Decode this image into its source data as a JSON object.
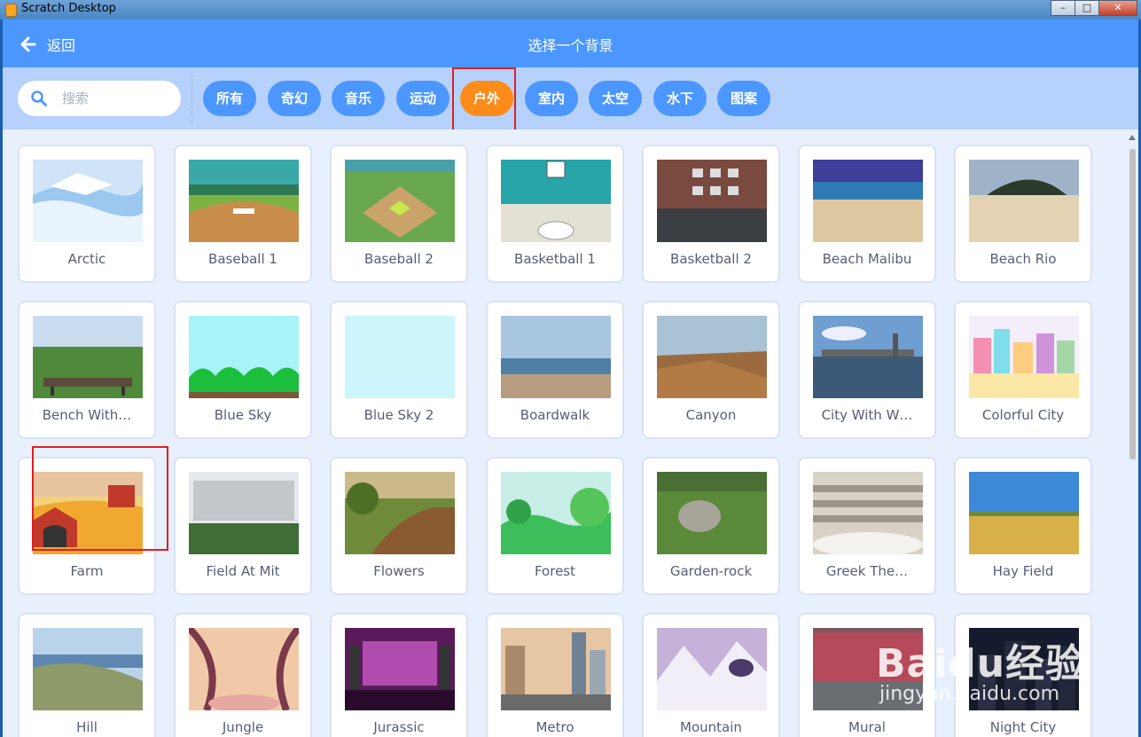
{
  "window": {
    "title": "Scratch Desktop",
    "minimize": "–",
    "maximize": "□",
    "close": "✕"
  },
  "header": {
    "back_label": "返回",
    "title": "选择一个背景"
  },
  "search": {
    "placeholder": "搜索"
  },
  "tags": [
    {
      "label": "所有"
    },
    {
      "label": "奇幻"
    },
    {
      "label": "音乐"
    },
    {
      "label": "运动"
    },
    {
      "label": "户外",
      "active": true
    },
    {
      "label": "室内"
    },
    {
      "label": "太空"
    },
    {
      "label": "水下"
    },
    {
      "label": "图案"
    }
  ],
  "backdrops": [
    {
      "name": "Arctic"
    },
    {
      "name": "Baseball 1"
    },
    {
      "name": "Baseball 2"
    },
    {
      "name": "Basketball 1"
    },
    {
      "name": "Basketball 2"
    },
    {
      "name": "Beach Malibu"
    },
    {
      "name": "Beach Rio"
    },
    {
      "name": "Bench With…"
    },
    {
      "name": "Blue Sky"
    },
    {
      "name": "Blue Sky 2"
    },
    {
      "name": "Boardwalk"
    },
    {
      "name": "Canyon"
    },
    {
      "name": "City With W…"
    },
    {
      "name": "Colorful City"
    },
    {
      "name": "Farm"
    },
    {
      "name": "Field At Mit"
    },
    {
      "name": "Flowers"
    },
    {
      "name": "Forest"
    },
    {
      "name": "Garden-rock"
    },
    {
      "name": "Greek The…"
    },
    {
      "name": "Hay Field"
    },
    {
      "name": "Hill"
    },
    {
      "name": "Jungle"
    },
    {
      "name": "Jurassic"
    },
    {
      "name": "Metro"
    },
    {
      "name": "Mountain"
    },
    {
      "name": "Mural"
    },
    {
      "name": "Night City"
    }
  ],
  "watermark": {
    "brand": "Baidu经验",
    "url": "jingyan.baidu.com"
  },
  "colors": {
    "header": "#4c97ff",
    "active_tag": "#ff8c1a",
    "filter_bar": "#b6d2fc",
    "highlight": "#e02020"
  }
}
